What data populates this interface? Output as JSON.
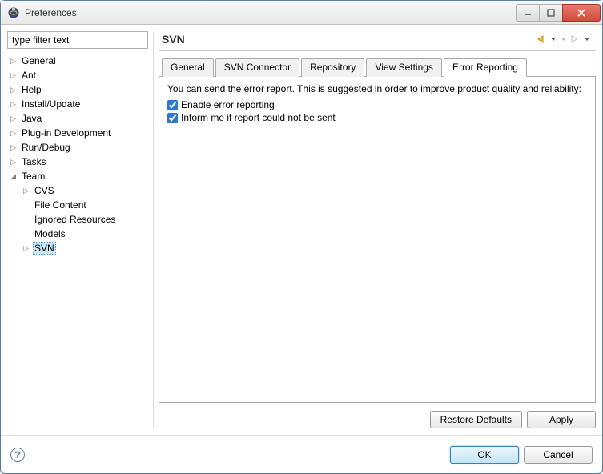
{
  "window": {
    "title": "Preferences"
  },
  "sidebar": {
    "filter_placeholder": "type filter text",
    "items": [
      {
        "label": "General",
        "expandable": true,
        "expanded": false,
        "depth": 0
      },
      {
        "label": "Ant",
        "expandable": true,
        "expanded": false,
        "depth": 0
      },
      {
        "label": "Help",
        "expandable": true,
        "expanded": false,
        "depth": 0
      },
      {
        "label": "Install/Update",
        "expandable": true,
        "expanded": false,
        "depth": 0
      },
      {
        "label": "Java",
        "expandable": true,
        "expanded": false,
        "depth": 0
      },
      {
        "label": "Plug-in Development",
        "expandable": true,
        "expanded": false,
        "depth": 0
      },
      {
        "label": "Run/Debug",
        "expandable": true,
        "expanded": false,
        "depth": 0
      },
      {
        "label": "Tasks",
        "expandable": true,
        "expanded": false,
        "depth": 0
      },
      {
        "label": "Team",
        "expandable": true,
        "expanded": true,
        "depth": 0
      },
      {
        "label": "CVS",
        "expandable": true,
        "expanded": false,
        "depth": 1
      },
      {
        "label": "File Content",
        "expandable": false,
        "expanded": false,
        "depth": 1
      },
      {
        "label": "Ignored Resources",
        "expandable": false,
        "expanded": false,
        "depth": 1
      },
      {
        "label": "Models",
        "expandable": false,
        "expanded": false,
        "depth": 1
      },
      {
        "label": "SVN",
        "expandable": true,
        "expanded": false,
        "depth": 1,
        "selected": true
      }
    ]
  },
  "main": {
    "title": "SVN",
    "tabs": [
      {
        "label": "General"
      },
      {
        "label": "SVN Connector"
      },
      {
        "label": "Repository"
      },
      {
        "label": "View Settings"
      },
      {
        "label": "Error Reporting",
        "active": true
      }
    ],
    "panel": {
      "intro": "You can send the error report. This is suggested in order to improve product quality and reliability:",
      "options": [
        {
          "label": "Enable error reporting",
          "checked": true
        },
        {
          "label": "Inform me if report could not be sent",
          "checked": true
        }
      ]
    },
    "restore_label": "Restore Defaults",
    "apply_label": "Apply"
  },
  "footer": {
    "ok_label": "OK",
    "cancel_label": "Cancel"
  }
}
